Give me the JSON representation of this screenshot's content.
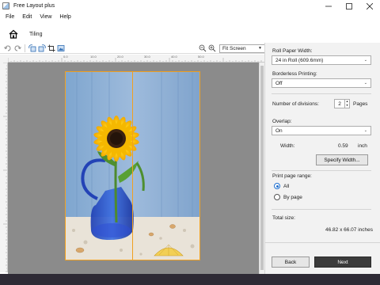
{
  "window": {
    "title": "Free Layout plus"
  },
  "menu": [
    "File",
    "Edit",
    "View",
    "Help"
  ],
  "mode": {
    "label": "Tiling"
  },
  "toolbar": {
    "icons": [
      "undo-icon",
      "redo-icon",
      "rotate-left-icon",
      "rotate-right-icon",
      "crop-icon",
      "fit-image-icon",
      "zoom-out-icon",
      "zoom-in-icon"
    ],
    "zoom_value": "Fit Screen"
  },
  "ruler": {
    "h_labels": [
      "0.0",
      "10.0",
      "20.0",
      "30.0",
      "40.0",
      "50.0"
    ],
    "v_labels": [
      "0.0",
      "10.0",
      "20.0",
      "30.0",
      "40.0",
      "50.0",
      "60.0",
      "70.0"
    ]
  },
  "panel": {
    "roll_paper_width_label": "Roll Paper Width:",
    "roll_paper_width_value": "24 in Roll (609.6mm)",
    "borderless_label": "Borderless Printing:",
    "borderless_value": "Off",
    "divisions_label": "Number of divisions:",
    "divisions_value": "2",
    "divisions_unit": "Pages",
    "overlap_label": "Overlap:",
    "overlap_value": "On",
    "width_label": "Width:",
    "width_value": "0.59",
    "width_unit": "inch",
    "specify_width_button": "Specify Width...",
    "print_range_label": "Print page range:",
    "range_all": "All",
    "range_by_page": "By page",
    "total_size_label": "Total size:",
    "total_size_value": "46.82 x 66.07 inches",
    "back_button": "Back",
    "next_button": "Next"
  },
  "colors": {
    "page_border": "#f0a020",
    "canvas_bg": "#8b8b8b",
    "primary_button": "#3b3b3b",
    "radio_accent": "#1f6fcf"
  }
}
